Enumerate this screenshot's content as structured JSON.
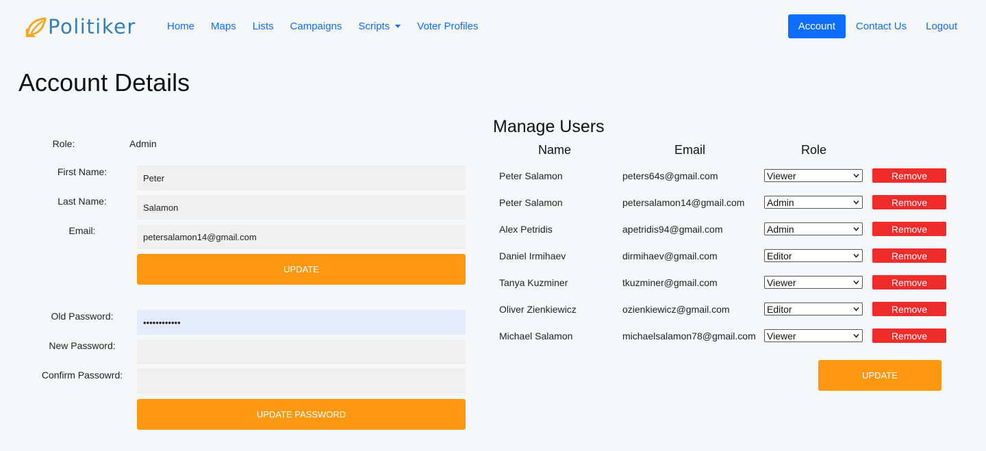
{
  "brand": {
    "name": "Politiker",
    "logo_icon": "leaf-logo-icon",
    "logo_color": "#f5a623",
    "text_color": "#2f7fc1"
  },
  "nav": {
    "links": [
      "Home",
      "Maps",
      "Lists",
      "Campaigns",
      "Scripts",
      "Voter Profiles"
    ],
    "right": [
      "Account",
      "Contact Us",
      "Logout"
    ],
    "active": "Account"
  },
  "page": {
    "title": "Account Details"
  },
  "account": {
    "role_label": "Role:",
    "role_value": "Admin",
    "first_name_label": "First Name:",
    "first_name": "Peter",
    "last_name_label": "Last Name:",
    "last_name": "Salamon",
    "email_label": "Email:",
    "email": "petersalamon14@gmail.com",
    "update_label": "UPDATE"
  },
  "password": {
    "old_label": "Old Password:",
    "old_value": "••••••••••••",
    "new_label": "New Password:",
    "new_value": "",
    "confirm_label": "Confirm Passowrd:",
    "confirm_value": "",
    "update_label": "UPDATE PASSWORD"
  },
  "manage_users": {
    "title": "Manage Users",
    "headers": {
      "name": "Name",
      "email": "Email",
      "role": "Role"
    },
    "users": [
      {
        "name": "Peter Salamon",
        "email": "peters64s@gmail.com",
        "role": "Viewer"
      },
      {
        "name": "Peter Salamon",
        "email": "petersalamon14@gmail.com",
        "role": "Admin"
      },
      {
        "name": "Alex Petridis",
        "email": "apetridis94@gmail.com",
        "role": "Admin"
      },
      {
        "name": "Daniel Irmihaev",
        "email": "dirmihaev@gmail.com",
        "role": "Editor"
      },
      {
        "name": "Tanya Kuzminer",
        "email": "tkuzminer@gmail.com",
        "role": "Viewer"
      },
      {
        "name": "Oliver Zienkiewicz",
        "email": "ozienkiewicz@gmail.com",
        "role": "Editor"
      },
      {
        "name": "Michael Salamon",
        "email": "michaelsalamon78@gmail.com",
        "role": "Viewer"
      }
    ],
    "remove_label": "Remove",
    "update_label": "UPDATE"
  },
  "colors": {
    "accent": "#0d6efd",
    "orange": "#fd9811",
    "danger": "#ee2c2c"
  }
}
